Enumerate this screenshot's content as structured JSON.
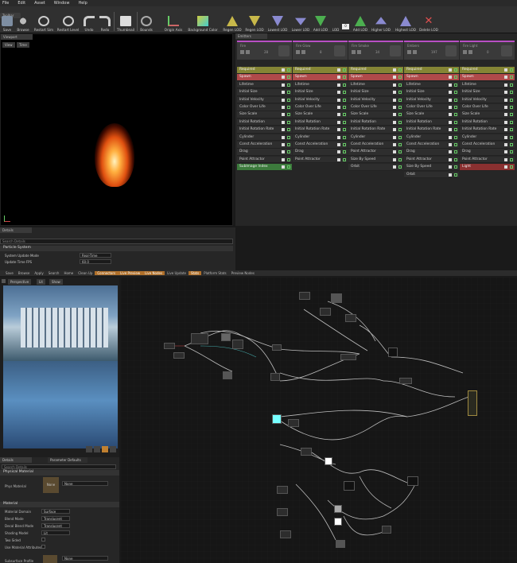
{
  "menu": [
    "File",
    "Edit",
    "Asset",
    "Window",
    "Help"
  ],
  "toolbar": {
    "tab": "Toolbar",
    "buttons": [
      "Save",
      "Browse",
      "Restart Sim",
      "Restart Level",
      "Undo",
      "Redo",
      "Thumbnail",
      "Bounds",
      "Origin Axis",
      "Background Color",
      "Regen LOD",
      "Regen LOD",
      "Lowest LOD",
      "Lower LOD",
      "Add LOD",
      "LOD",
      "Add LOD",
      "Higher LOD",
      "Highest LOD",
      "Delete LOD"
    ],
    "lod_value": "0"
  },
  "viewport": {
    "tab": "Viewport",
    "view": "View",
    "time": "Time"
  },
  "emitters": {
    "tab": "Emitters",
    "columns": [
      {
        "name": "Fire",
        "count": "28",
        "rows": [
          "Required",
          "Spawn",
          "Lifetime",
          "Initial Size",
          "Initial Velocity",
          "Color Over Life",
          "Size Scale",
          "Initial Rotation",
          "Initial Rotation Rate",
          "Cylinder",
          "Const Acceleration",
          "Drag",
          "Point Attractor",
          "SubImage Index"
        ]
      },
      {
        "name": "Fire Glow",
        "count": "8",
        "rows": [
          "Required",
          "Spawn",
          "Lifetime",
          "Initial Size",
          "Initial Velocity",
          "Color Over Life",
          "Size Scale",
          "Initial Rotation",
          "Initial Rotation Rate",
          "Cylinder",
          "Const Acceleration",
          "Drag",
          "Point Attractor"
        ]
      },
      {
        "name": "Fire Smoke",
        "count": "34",
        "rows": [
          "Required",
          "Spawn",
          "Lifetime",
          "Initial Size",
          "Initial Velocity",
          "Color Over Life",
          "Size Scale",
          "Initial Rotation",
          "Initial Rotation Rate",
          "Cylinder",
          "Const Acceleration",
          "Point Attractor",
          "Size By Speed",
          "Orbit"
        ]
      },
      {
        "name": "Embers",
        "count": "197",
        "rows": [
          "Required",
          "Spawn",
          "Lifetime",
          "Initial Size",
          "Initial Velocity",
          "Color Over Life",
          "Size Scale",
          "Initial Rotation",
          "Initial Rotation Rate",
          "Cylinder",
          "Const Acceleration",
          "Drag",
          "Point Attractor",
          "Size By Speed",
          "Orbit"
        ]
      },
      {
        "name": "Fire Light",
        "count": "0",
        "rows": [
          "Required",
          "Spawn",
          "Lifetime",
          "Initial Size",
          "Initial Velocity",
          "Color Over Life",
          "Size Scale",
          "Initial Rotation",
          "Initial Rotation Rate",
          "Cylinder",
          "Const Acceleration",
          "Drag",
          "Point Attractor",
          "Light"
        ]
      }
    ]
  },
  "details": {
    "tab": "Details",
    "search": "Search Details",
    "section": "Particle System",
    "row1_label": "System Update Mode",
    "row1_value": "Real-Time",
    "row2_label": "Update Time FPS",
    "row2_value": "60.0"
  },
  "matbar": [
    "Save",
    "Browse",
    "Apply",
    "Search",
    "Home",
    "Clean Up",
    "Connectors",
    "Live Preview",
    "Live Nodes",
    "Live Update",
    "Stats",
    "Platform Stats",
    "Preview Nodes"
  ],
  "preview": {
    "mode": "Perspective",
    "lit": "Lit",
    "show": "Show"
  },
  "matdetails": {
    "tab1": "Details",
    "tab2": "Parameter Defaults",
    "search": "Search Details",
    "section1": "Physical Material",
    "phys_label": "Phys Material",
    "phys_value": "None",
    "section2": "Material",
    "rows": [
      {
        "label": "Material Domain",
        "value": "Surface"
      },
      {
        "label": "Blend Mode",
        "value": "Translucent"
      },
      {
        "label": "Decal Blend Mode",
        "value": "Translucent"
      },
      {
        "label": "Shading Model",
        "value": "Lit"
      },
      {
        "label": "Two Sided",
        "value": ""
      },
      {
        "label": "Use Material Attributes",
        "value": ""
      }
    ],
    "subsurface_label": "Subsurface Profile",
    "subsurface_value": "None"
  },
  "colors": {
    "accent_orange": "#b0702a",
    "emitter_purple": "#b84fc4",
    "required_yellow": "#858535",
    "spawn_red": "#b04a4a"
  }
}
